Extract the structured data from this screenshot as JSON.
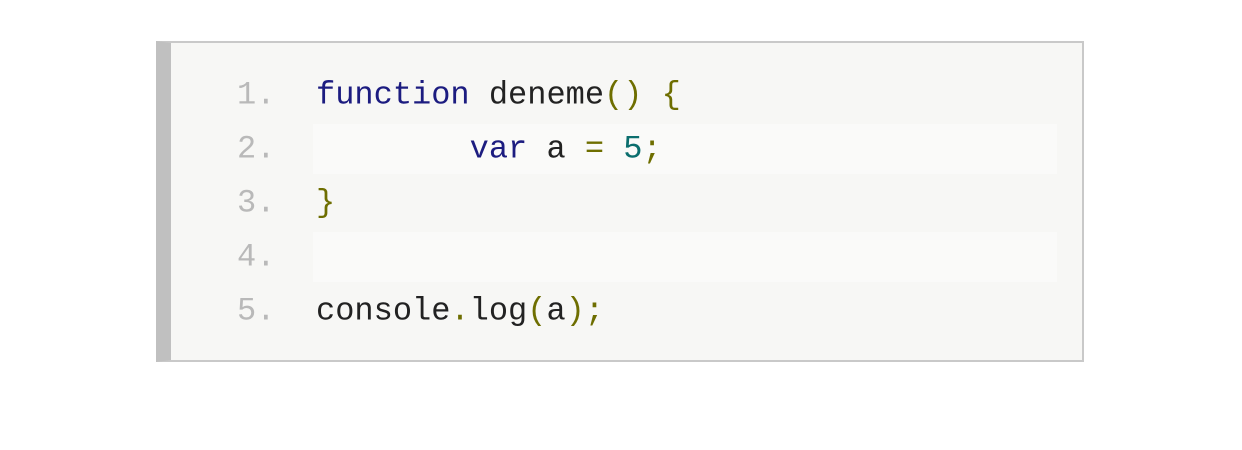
{
  "colors": {
    "keyword": "#1c1c80",
    "identifier": "#222222",
    "punctuation": "#6e6e00",
    "literal": "#0b6e6e",
    "line_number": "#b9b9b9",
    "background": "#f7f7f5",
    "gutter_bar": "#c0c0c0"
  },
  "lines": [
    {
      "number": "1.",
      "tokens": [
        {
          "type": "kw",
          "text": "function"
        },
        {
          "type": "id",
          "text": " deneme"
        },
        {
          "type": "pn",
          "text": "()"
        },
        {
          "type": "id",
          "text": " "
        },
        {
          "type": "pn",
          "text": "{"
        }
      ]
    },
    {
      "number": "2.",
      "tokens": [
        {
          "type": "id",
          "text": "        "
        },
        {
          "type": "kw",
          "text": "var"
        },
        {
          "type": "id",
          "text": " a "
        },
        {
          "type": "pn",
          "text": "="
        },
        {
          "type": "id",
          "text": " "
        },
        {
          "type": "lit",
          "text": "5"
        },
        {
          "type": "pn",
          "text": ";"
        }
      ]
    },
    {
      "number": "3.",
      "tokens": [
        {
          "type": "pn",
          "text": "}"
        }
      ]
    },
    {
      "number": "4.",
      "tokens": []
    },
    {
      "number": "5.",
      "tokens": [
        {
          "type": "id",
          "text": "console"
        },
        {
          "type": "pn",
          "text": "."
        },
        {
          "type": "id",
          "text": "log"
        },
        {
          "type": "pn",
          "text": "("
        },
        {
          "type": "id",
          "text": "a"
        },
        {
          "type": "pn",
          "text": ");"
        }
      ]
    }
  ]
}
